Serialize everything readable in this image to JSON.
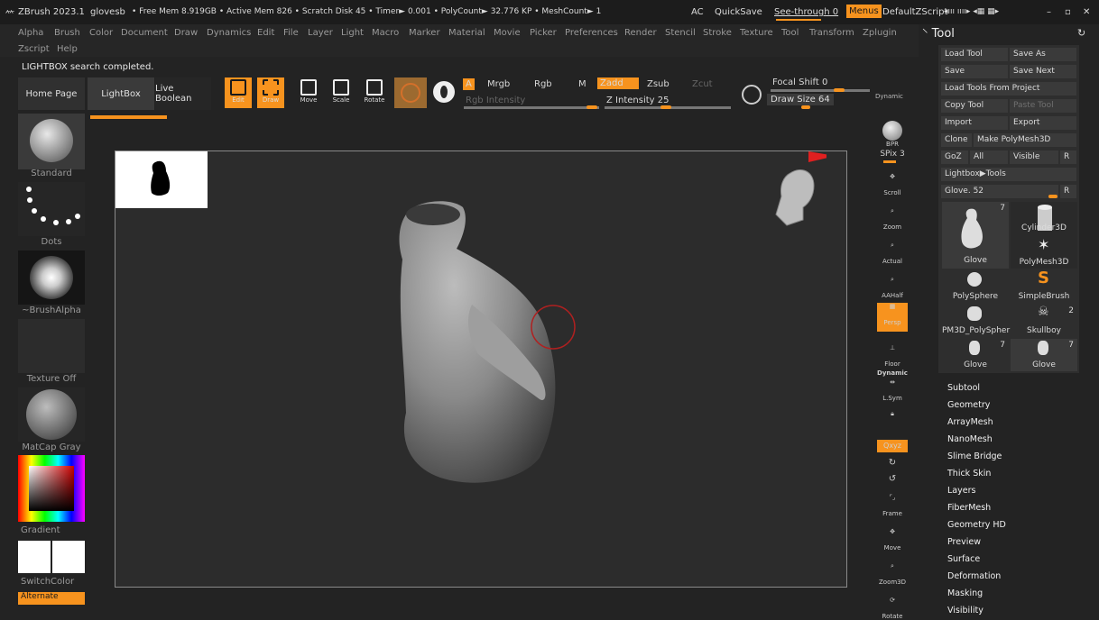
{
  "titlebar": {
    "app": "ZBrush 2023.1",
    "file": "glovesb",
    "stats": "• Free Mem 8.919GB • Active Mem 826 • Scratch Disk 45 • Timer► 0.001 • PolyCount► 32.776 KP • MeshCount► 1",
    "ac": "AC",
    "quicksave": "QuickSave",
    "seethrough": "See-through 0",
    "menus": "Menus",
    "zscript": "DefaultZScript"
  },
  "menus": [
    "Alpha",
    "Brush",
    "Color",
    "Document",
    "Draw",
    "Dynamics",
    "Edit",
    "File",
    "Layer",
    "Light",
    "Macro",
    "Marker",
    "Material",
    "Movie",
    "Picker",
    "Preferences",
    "Render",
    "Stencil",
    "Stroke",
    "Texture",
    "Tool",
    "Transform",
    "Zplugin"
  ],
  "menus2": [
    "Zscript",
    "Help"
  ],
  "status": "LIGHTBOX search completed.",
  "shelf": {
    "home": "Home Page",
    "lightbox": "LightBox",
    "liveboolean": "Live Boolean"
  },
  "tools": {
    "edit": "Edit",
    "draw": "Draw",
    "move": "Move",
    "scale": "Scale",
    "rotate": "Rotate"
  },
  "modes": {
    "a": "A",
    "mrgb": "Mrgb",
    "rgb": "Rgb",
    "m": "M",
    "zadd": "Zadd",
    "zsub": "Zsub",
    "zcut": "Zcut",
    "rgbint": "Rgb Intensity",
    "zint": "Z Intensity 25",
    "focal": "Focal Shift 0",
    "drawsize": "Draw Size 64",
    "dynamic": "Dynamic"
  },
  "left": {
    "standard": "Standard",
    "dots": "Dots",
    "brushalpha": "~BrushAlpha",
    "texture": "Texture Off",
    "matcap": "MatCap Gray",
    "gradient": "Gradient",
    "switchcolor": "SwitchColor",
    "alternate": "Alternate"
  },
  "right": {
    "bpr": "BPR",
    "spix": "SPix 3",
    "scroll": "Scroll",
    "zoom": "Zoom",
    "actual": "Actual",
    "aahalf": "AAHalf",
    "persp": "Persp",
    "floor": "Floor",
    "dyn": "Dynamic",
    "lsym": "L.Sym",
    "xyz": "Qxyz",
    "frame": "Frame",
    "move": "Move",
    "zoom3d": "Zoom3D",
    "rotate": "Rotate"
  },
  "toolpanel": {
    "title": "Tool",
    "buttons": [
      "Load Tool",
      "Save As",
      "Save",
      "Save Next",
      "Load Tools From Project",
      "Copy Tool",
      "Paste Tool",
      "Import",
      "Export",
      "Clone",
      "Make PolyMesh3D",
      "GoZ",
      "All",
      "Visible",
      "R",
      "Lightbox▶Tools",
      "Glove. 52",
      "R"
    ],
    "thumbs": [
      {
        "name": "Glove",
        "count": "7"
      },
      {
        "name": "Cylinder3D",
        "count": ""
      },
      {
        "name": "PolyMesh3D",
        "count": ""
      },
      {
        "name": "PolySphere",
        "count": ""
      },
      {
        "name": "SimpleBrush",
        "count": ""
      },
      {
        "name": "PM3D_PolySpher",
        "count": ""
      },
      {
        "name": "Skullboy",
        "count": "2"
      },
      {
        "name": "Glove",
        "count": "7"
      },
      {
        "name": "Glove",
        "count": "7"
      }
    ],
    "subpalettes": [
      "Subtool",
      "Geometry",
      "ArrayMesh",
      "NanoMesh",
      "Slime Bridge",
      "Thick Skin",
      "Layers",
      "FiberMesh",
      "Geometry HD",
      "Preview",
      "Surface",
      "Deformation",
      "Masking",
      "Visibility"
    ]
  },
  "colors": {
    "accent": "#f7931e",
    "bg": "#232323",
    "panel": "#3a3a3a"
  }
}
